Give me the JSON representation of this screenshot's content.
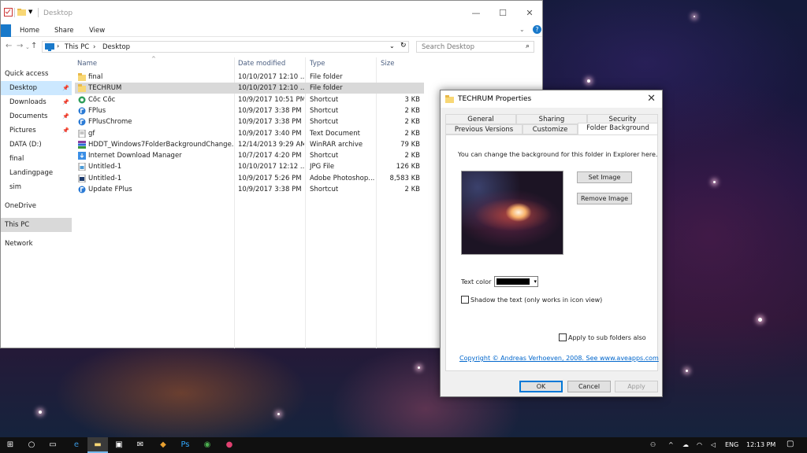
{
  "explorer": {
    "title": "Desktop",
    "ribbon_tabs": [
      "Home",
      "Share",
      "View"
    ],
    "breadcrumb": [
      "This PC",
      "Desktop"
    ],
    "search_placeholder": "Search Desktop",
    "columns": {
      "name": "Name",
      "date": "Date modified",
      "type": "Type",
      "size": "Size"
    },
    "nav": [
      {
        "label": "Quick access",
        "pinned": false
      },
      {
        "label": "Desktop",
        "pinned": true
      },
      {
        "label": "Downloads",
        "pinned": true
      },
      {
        "label": "Documents",
        "pinned": true
      },
      {
        "label": "Pictures",
        "pinned": true
      },
      {
        "label": "DATA (D:)",
        "pinned": false
      },
      {
        "label": "final",
        "pinned": false
      },
      {
        "label": "Landingpage",
        "pinned": false
      },
      {
        "label": "sim",
        "pinned": false
      },
      {
        "label": "OneDrive",
        "pinned": false
      },
      {
        "label": "This PC",
        "pinned": false
      },
      {
        "label": "Network",
        "pinned": false
      }
    ],
    "files": [
      {
        "name": "final",
        "date": "10/10/2017 12:10 ...",
        "type": "File folder",
        "size": "",
        "icon": "folder-icon"
      },
      {
        "name": "TECHRUM",
        "date": "10/10/2017 12:10 ...",
        "type": "File folder",
        "size": "",
        "icon": "folder-icon"
      },
      {
        "name": "Cốc Cốc",
        "date": "10/9/2017 10:51 PM",
        "type": "Shortcut",
        "size": "3 KB",
        "icon": "browser-icon"
      },
      {
        "name": "FPlus",
        "date": "10/9/2017 3:38 PM",
        "type": "Shortcut",
        "size": "2 KB",
        "icon": "fplus-icon"
      },
      {
        "name": "FPlusChrome",
        "date": "10/9/2017 3:38 PM",
        "type": "Shortcut",
        "size": "2 KB",
        "icon": "fplus-icon"
      },
      {
        "name": "gf",
        "date": "10/9/2017 3:40 PM",
        "type": "Text Document",
        "size": "2 KB",
        "icon": "text-file-icon"
      },
      {
        "name": "HDDT_Windows7FolderBackgroundChange...",
        "date": "12/14/2013 9:29 AM",
        "type": "WinRAR archive",
        "size": "79 KB",
        "icon": "archive-icon"
      },
      {
        "name": "Internet Download Manager",
        "date": "10/7/2017 4:20 PM",
        "type": "Shortcut",
        "size": "2 KB",
        "icon": "idm-icon"
      },
      {
        "name": "Untitled-1",
        "date": "10/10/2017 12:12 ...",
        "type": "JPG File",
        "size": "126 KB",
        "icon": "image-file-icon"
      },
      {
        "name": "Untitled-1",
        "date": "10/9/2017 5:26 PM",
        "type": "Adobe Photoshop...",
        "size": "8,583 KB",
        "icon": "psd-file-icon"
      },
      {
        "name": "Update FPlus",
        "date": "10/9/2017 3:38 PM",
        "type": "Shortcut",
        "size": "2 KB",
        "icon": "fplus-icon"
      }
    ]
  },
  "dialog": {
    "title": "TECHRUM Properties",
    "tabs_row1": [
      "General",
      "Sharing",
      "Security"
    ],
    "tabs_row2": [
      "Previous Versions",
      "Customize",
      "Folder Background"
    ],
    "description": "You can change the background for this folder in Explorer here.",
    "set_image": "Set Image",
    "remove_image": "Remove Image",
    "text_color_label": "Text color",
    "text_color_value": "#000000",
    "shadow_label": "Shadow the text (only works in icon view)",
    "subfolders_label": "Apply to sub folders also",
    "copyright_link": "Copyright © Andreas Verhoeven, 2008. See www.aveapps.com",
    "ok": "OK",
    "cancel": "Cancel",
    "apply": "Apply"
  },
  "taskbar": {
    "language": "ENG",
    "time": "12:13 PM"
  },
  "colors": {
    "accent": "#0078d7",
    "selection": "#cce8ff",
    "link": "#0066cc"
  }
}
